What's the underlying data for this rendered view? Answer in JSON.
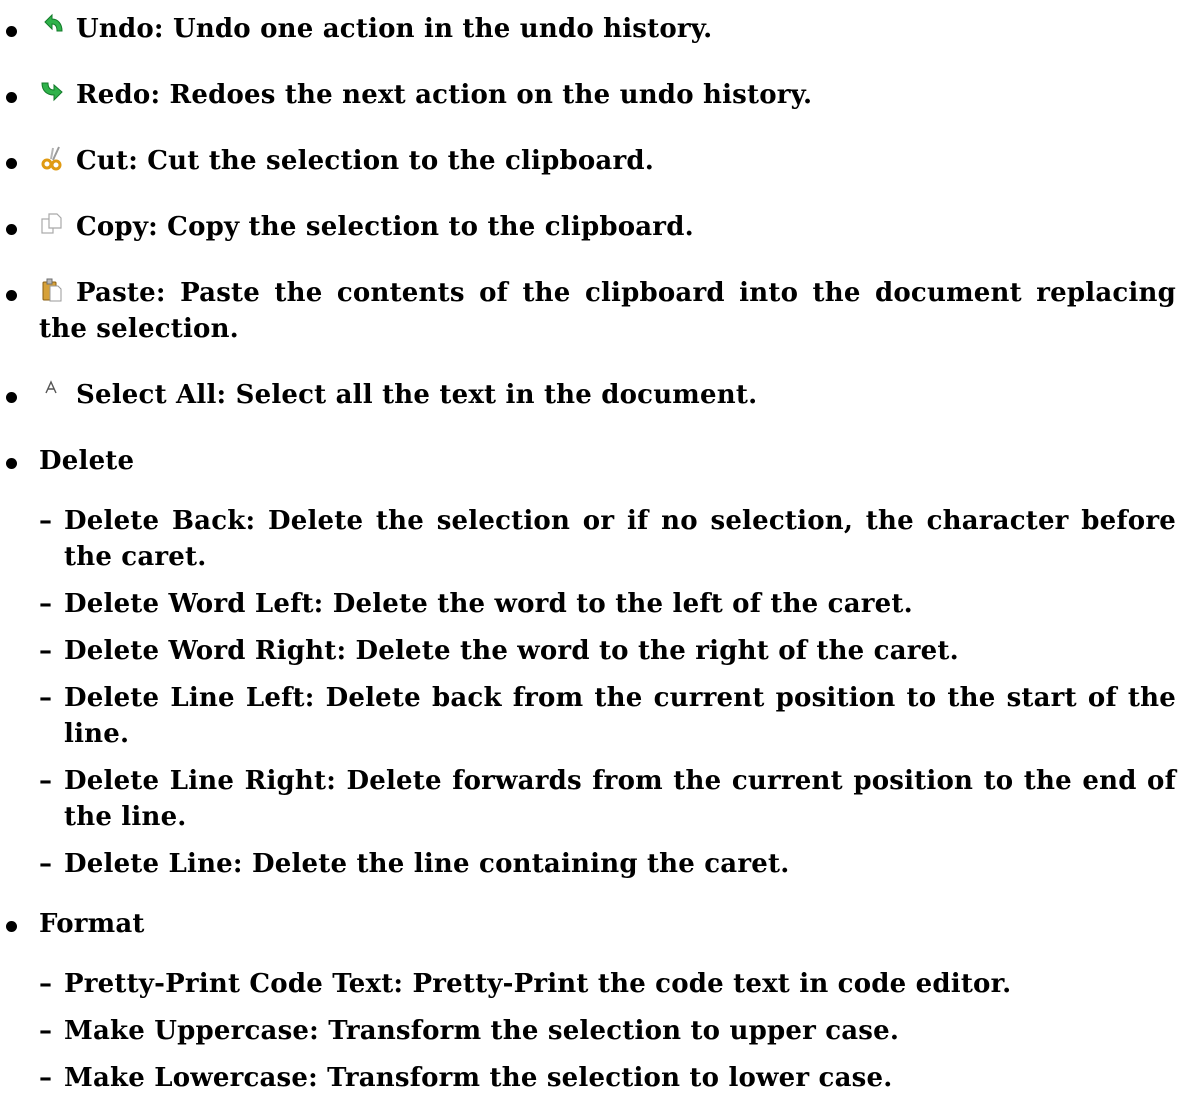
{
  "items": [
    {
      "icon": "undo-icon",
      "text": "Undo: Undo one action in the undo history."
    },
    {
      "icon": "redo-icon",
      "text": "Redo: Redoes the next action on the undo history."
    },
    {
      "icon": "cut-icon",
      "text": "Cut: Cut the selection to the clipboard."
    },
    {
      "icon": "copy-icon",
      "text": "Copy: Copy the selection to the clipboard."
    },
    {
      "icon": "paste-icon",
      "text": "Paste: Paste the contents of the clipboard into the document replacing the selection."
    },
    {
      "icon": "select-all-icon",
      "text": "Select All: Select all the text in the document."
    }
  ],
  "delete": {
    "label": "Delete",
    "items": [
      "Delete Back: Delete the selection or if no selection, the character before the caret.",
      "Delete Word Left: Delete the word to the left of the caret.",
      "Delete Word Right: Delete the word to the right of the caret.",
      "Delete Line Left: Delete back from the current position to the start of the line.",
      "Delete Line Right: Delete forwards from the current position to the end of the line.",
      "Delete Line: Delete the line containing the caret."
    ]
  },
  "format": {
    "label": "Format",
    "items": [
      "Pretty-Print Code Text: Pretty-Print the code text in code editor.",
      "Make Uppercase: Transform the selection to upper case.",
      "Make Lowercase: Transform the selection to lower case."
    ]
  },
  "dash_glyph": "–"
}
